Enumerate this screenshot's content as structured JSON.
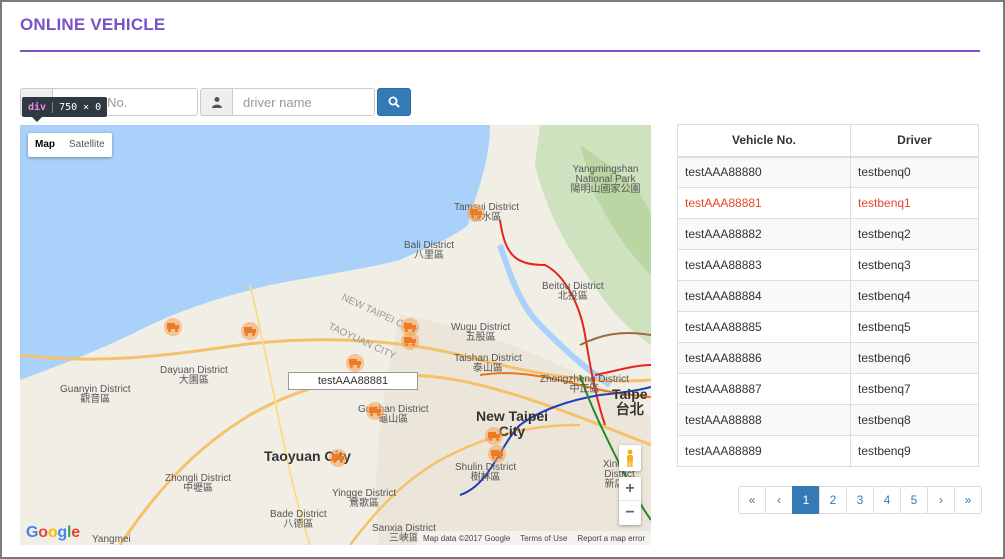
{
  "page": {
    "title": "ONLINE VEHICLE"
  },
  "search": {
    "vehicle_placeholder": "vehicle No.",
    "vehicle_visible_text": "e No.",
    "driver_placeholder": "driver name",
    "button_icon": "search-icon",
    "vehicle_addon_icon": "car-icon",
    "driver_addon_icon": "user-icon"
  },
  "devtools_tooltip": {
    "tag": "div",
    "size": "750 × 0"
  },
  "map": {
    "type_control": [
      "Map",
      "Satellite"
    ],
    "selected_type": "Map",
    "selected_vehicle_label": "testAAA88881",
    "labels": {
      "tamsui": "Tamsui District",
      "tamsui_zh": "淡水區",
      "bali": "Bali District",
      "bali_zh": "八里區",
      "yangming": "Yangmingshan National Park",
      "yangming_zh": "陽明山國家公園",
      "beitou": "Beitou District",
      "beitou_zh": "北投區",
      "wugu": "Wugu District",
      "wugu_zh": "五股區",
      "taishan": "Taishan District",
      "taishan_zh": "泰山區",
      "zhongzheng": "Zhongzheng District",
      "zhongzheng_zh": "中正區",
      "taipei": "Taipe",
      "taipei_zh": "台北",
      "new_taipei": "New Taipei City",
      "guanyin": "Guanyin District",
      "guanyin_zh": "觀音區",
      "dayuan": "Dayuan District",
      "dayuan_zh": "大園區",
      "guishan": "Guishan District",
      "guishan_zh": "龜山區",
      "taoyuan": "Taoyuan City",
      "shulin": "Shulin District",
      "shulin_zh": "樹林區",
      "xindian": "Xindian District",
      "xindian_zh": "新店區",
      "zhongli": "Zhongli District",
      "zhongli_zh": "中壢區",
      "yingge": "Yingge District",
      "yingge_zh": "鶯歌區",
      "bade": "Bade District",
      "bade_zh": "八德區",
      "sanxia": "Sanxia District",
      "sanxia_zh": "三峽區",
      "yangmei": "Yangmei",
      "new_taipei_ghost": "NEW TAIPEI CITY",
      "taoyuan_ghost": "TAOYUAN CITY"
    },
    "footer": {
      "data": "Map data ©2017 Google",
      "terms": "Terms of Use",
      "report": "Report a map error"
    },
    "zoom_in": "+",
    "zoom_out": "−",
    "logo": "Google"
  },
  "table": {
    "headers": [
      "Vehicle No.",
      "Driver"
    ],
    "rows": [
      [
        "testAAA88880",
        "testbenq0"
      ],
      [
        "testAAA88881",
        "testbenq1"
      ],
      [
        "testAAA88882",
        "testbenq2"
      ],
      [
        "testAAA88883",
        "testbenq3"
      ],
      [
        "testAAA88884",
        "testbenq4"
      ],
      [
        "testAAA88885",
        "testbenq5"
      ],
      [
        "testAAA88886",
        "testbenq6"
      ],
      [
        "testAAA88887",
        "testbenq7"
      ],
      [
        "testAAA88888",
        "testbenq8"
      ],
      [
        "testAAA88889",
        "testbenq9"
      ]
    ],
    "selected_index": 1,
    "selected_color": "#e8462a"
  },
  "pagination": {
    "items": [
      "«",
      "‹",
      "1",
      "2",
      "3",
      "4",
      "5",
      "›",
      "»"
    ],
    "active": "1"
  },
  "colors": {
    "accent": "#7a52c7",
    "primary": "#337ab7",
    "water": "#a9d1fa",
    "marker": "#f6a15a"
  }
}
